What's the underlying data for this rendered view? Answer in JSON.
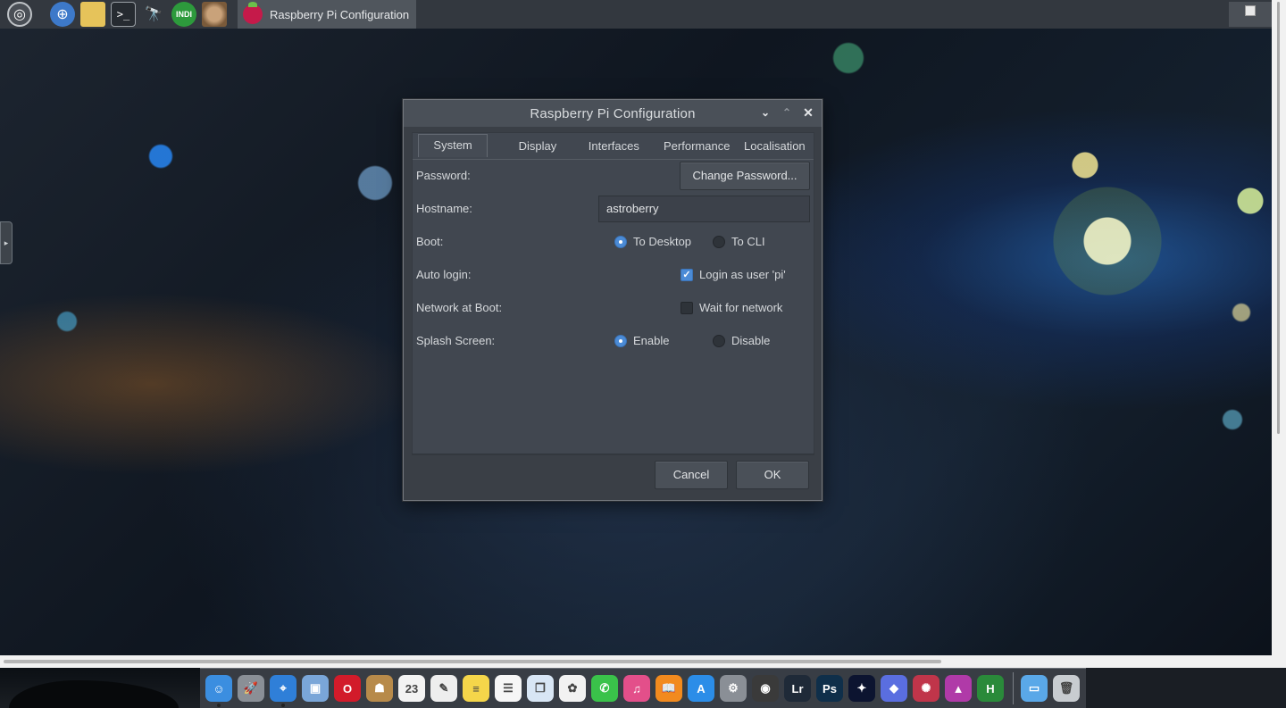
{
  "taskbar": {
    "launchers": [
      {
        "name": "menu-icon",
        "glyph": "◎"
      },
      {
        "name": "browser-icon",
        "glyph": "⊕"
      },
      {
        "name": "file-manager-icon",
        "glyph": ""
      },
      {
        "name": "terminal-icon",
        "glyph": ">_"
      },
      {
        "name": "telescope-icon",
        "glyph": "🔭"
      },
      {
        "name": "indi-icon",
        "glyph": "INDI"
      },
      {
        "name": "planet-icon",
        "glyph": ""
      }
    ],
    "task_title": "Raspberry Pi Configuration"
  },
  "dialog": {
    "title": "Raspberry Pi Configuration",
    "controls": {
      "minimize": "⌄",
      "maximize": "⌃",
      "close": "✕"
    },
    "tabs": [
      {
        "label": "System",
        "active": true
      },
      {
        "label": "Display",
        "active": false
      },
      {
        "label": "Interfaces",
        "active": false
      },
      {
        "label": "Performance",
        "active": false
      },
      {
        "label": "Localisation",
        "active": false
      }
    ],
    "rows": {
      "password": {
        "label": "Password:",
        "button": "Change Password..."
      },
      "hostname": {
        "label": "Hostname:",
        "value": "astroberry"
      },
      "boot": {
        "label": "Boot:",
        "option1": "To Desktop",
        "option2": "To CLI",
        "selected": "To Desktop"
      },
      "autologin": {
        "label": "Auto login:",
        "option": "Login as user 'pi'",
        "checked": true
      },
      "network": {
        "label": "Network at Boot:",
        "option": "Wait for network",
        "checked": false
      },
      "splash": {
        "label": "Splash Screen:",
        "option1": "Enable",
        "option2": "Disable",
        "selected": "Enable"
      }
    },
    "buttons": {
      "cancel": "Cancel",
      "ok": "OK"
    }
  },
  "dock": {
    "apps": [
      {
        "name": "finder-icon",
        "color": "#3b8ee0",
        "glyph": "☺"
      },
      {
        "name": "launchpad-icon",
        "color": "#8a8f96",
        "glyph": "🚀"
      },
      {
        "name": "safari-icon",
        "color": "#2f7fd8",
        "glyph": "⌖"
      },
      {
        "name": "preview-icon",
        "color": "#7aa6d8",
        "glyph": "▣"
      },
      {
        "name": "opera-icon",
        "color": "#d21b2a",
        "glyph": "O"
      },
      {
        "name": "contacts-icon",
        "color": "#b78a4a",
        "glyph": "☗"
      },
      {
        "name": "calendar-icon",
        "color": "#f3f3f3",
        "glyph": "23"
      },
      {
        "name": "textedit-icon",
        "color": "#eeeeee",
        "glyph": "✎"
      },
      {
        "name": "notes-icon",
        "color": "#f5d64a",
        "glyph": "≡"
      },
      {
        "name": "reminders-icon",
        "color": "#f6f6f6",
        "glyph": "☰"
      },
      {
        "name": "preview-photos-icon",
        "color": "#d8e6f5",
        "glyph": "❐"
      },
      {
        "name": "photos-icon",
        "color": "#f2f2f2",
        "glyph": "✿"
      },
      {
        "name": "facetime-icon",
        "color": "#3ac24a",
        "glyph": "✆"
      },
      {
        "name": "itunes-icon",
        "color": "#e34f8a",
        "glyph": "♫"
      },
      {
        "name": "ibooks-icon",
        "color": "#f28a1e",
        "glyph": "📖"
      },
      {
        "name": "app-store-icon",
        "color": "#2b8de8",
        "glyph": "A"
      },
      {
        "name": "system-preferences-icon",
        "color": "#8a8f96",
        "glyph": "⚙"
      },
      {
        "name": "camera-icon",
        "color": "#3a3a3a",
        "glyph": "◉"
      },
      {
        "name": "lightroom-icon",
        "color": "#1f2a38",
        "glyph": "Lr"
      },
      {
        "name": "photoshop-icon",
        "color": "#0f2f4a",
        "glyph": "Ps"
      },
      {
        "name": "stellarium-icon",
        "color": "#0c1430",
        "glyph": "✦"
      },
      {
        "name": "cube-icon",
        "color": "#5a6ee0",
        "glyph": "◆"
      },
      {
        "name": "paint-icon",
        "color": "#c0354a",
        "glyph": "✺"
      },
      {
        "name": "affinity-photo-icon",
        "color": "#b03aa8",
        "glyph": "▲"
      },
      {
        "name": "hdr-icon",
        "color": "#2a8a3a",
        "glyph": "H"
      },
      {
        "name": "folder-icon",
        "color": "#5aa8e8",
        "glyph": "▭"
      },
      {
        "name": "trash-icon",
        "color": "#c8ccd0",
        "glyph": "🗑"
      }
    ]
  }
}
